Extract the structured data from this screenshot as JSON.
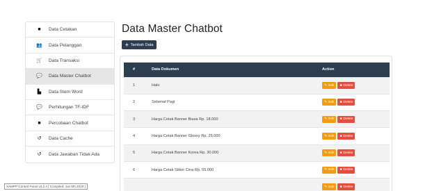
{
  "sidebar": {
    "items": [
      {
        "label": "Data Cetakan",
        "icon": "file-icon",
        "glyph": "■"
      },
      {
        "label": "Data Pelanggan",
        "icon": "users-icon",
        "glyph": "👥"
      },
      {
        "label": "Data Transaksi",
        "icon": "cart-icon",
        "glyph": "🛒"
      },
      {
        "label": "Data Master Chatbot",
        "icon": "comments-icon",
        "glyph": "💬"
      },
      {
        "label": "Data Stem Word",
        "icon": "document-icon",
        "glyph": "▙"
      },
      {
        "label": "Perhitungan TF-IDF",
        "icon": "comments-icon",
        "glyph": "💬"
      },
      {
        "label": "Percobaan Chatbot",
        "icon": "chat-icon",
        "glyph": "■"
      },
      {
        "label": "Data Cache",
        "icon": "history-icon",
        "glyph": "↺"
      },
      {
        "label": "Data Jawaban Tidak Ada",
        "icon": "history-icon",
        "glyph": "↺"
      }
    ]
  },
  "footer": {
    "text": "XAMPP Control Panel v3.2.4  [ Compiled: Jun 5th 2019 ]"
  },
  "main": {
    "title": "Data Master Chatbot",
    "add_button": "Tambah Data",
    "add_icon": "plus-icon",
    "table": {
      "headers": [
        "#",
        "Data Dokumen",
        "Action"
      ],
      "rows": [
        {
          "no": "1",
          "doc": "Halo"
        },
        {
          "no": "2",
          "doc": "Selamat Pagi"
        },
        {
          "no": "3",
          "doc": "Harga Cetak Banner Biasa Rp. 18.000"
        },
        {
          "no": "4",
          "doc": "Harga Cetak Banner Glossy Rp. 25.000"
        },
        {
          "no": "5",
          "doc": "Harga Cetak Banner Korea Rp. 30.000"
        },
        {
          "no": "6",
          "doc": "Harga Cetak Stiker Cina Rp. 55.000"
        },
        {
          "no": "",
          "doc": ""
        }
      ],
      "edit_label": "Edit",
      "delete_label": "Delete",
      "edit_icon": "edit-icon",
      "delete_icon": "trash-icon"
    }
  },
  "colors": {
    "header_bg": "#2c3e50",
    "edit": "#f39c12",
    "delete": "#e74c3c"
  }
}
